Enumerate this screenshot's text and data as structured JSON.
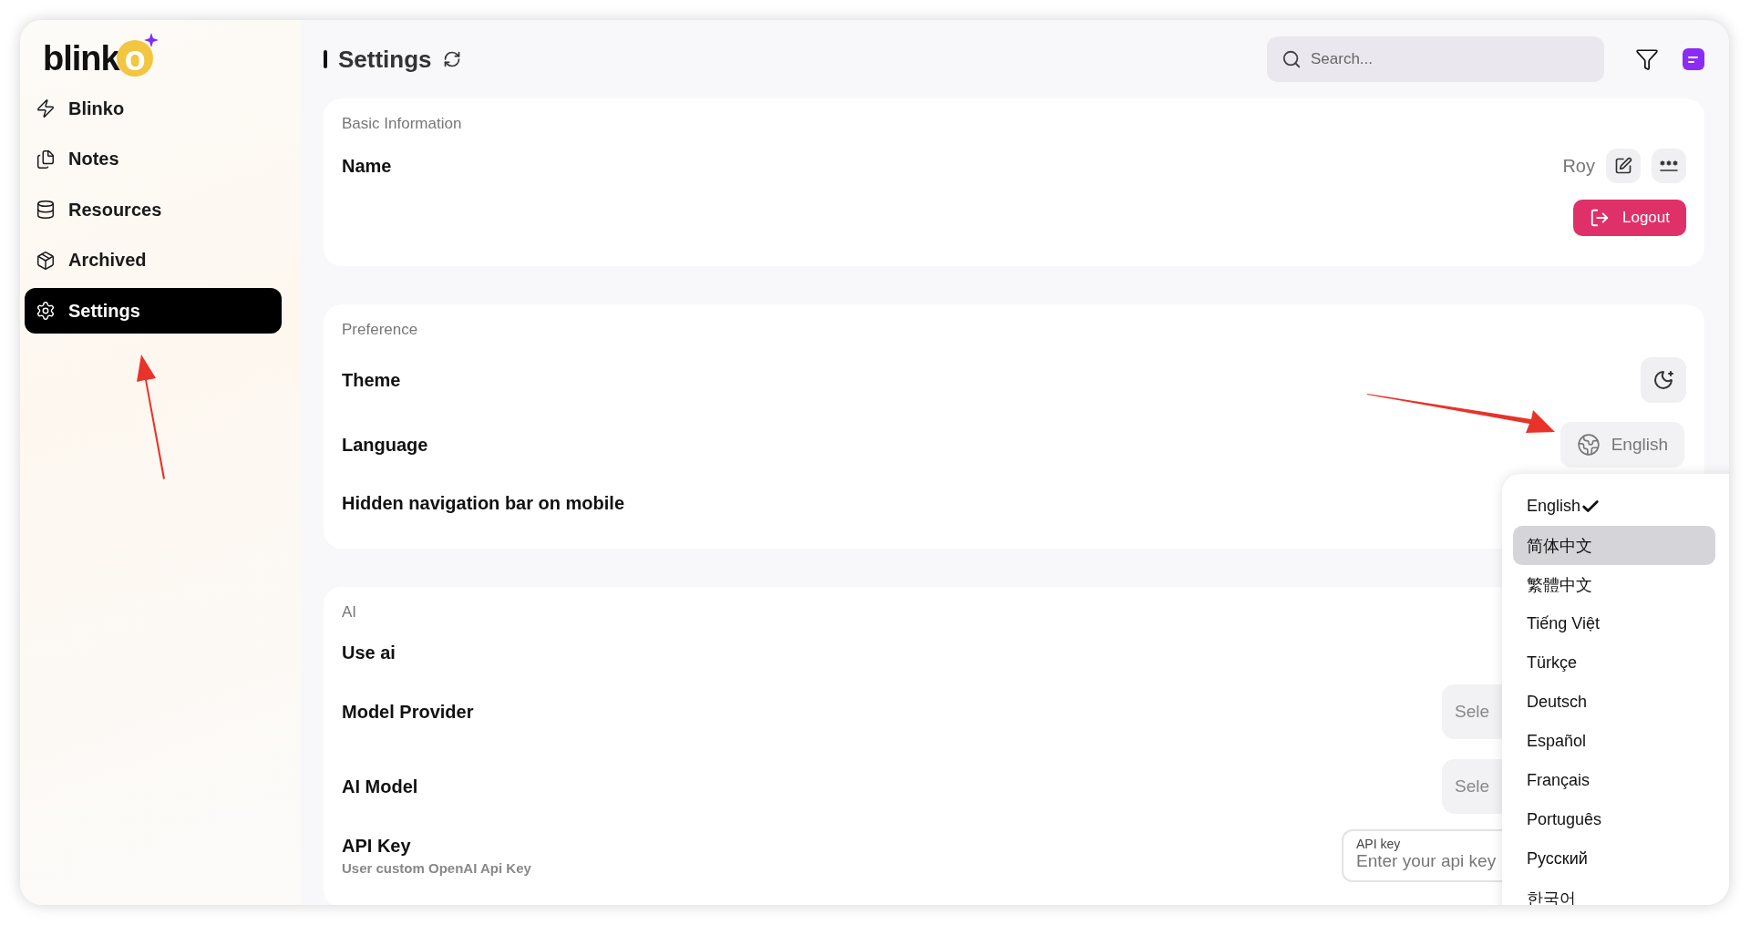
{
  "logo": {
    "text": "blinko"
  },
  "sidebar": {
    "items": [
      {
        "label": "Blinko",
        "selected": false
      },
      {
        "label": "Notes",
        "selected": false
      },
      {
        "label": "Resources",
        "selected": false
      },
      {
        "label": "Archived",
        "selected": false
      },
      {
        "label": "Settings",
        "selected": true
      }
    ]
  },
  "header": {
    "title": "Settings",
    "search": {
      "placeholder": "Search..."
    }
  },
  "sections": [
    {
      "title": "Basic Information",
      "rows": [
        {
          "kind": "name",
          "label": "Name",
          "value": "Roy"
        },
        {
          "kind": "button",
          "button": "Logout"
        }
      ]
    },
    {
      "title": "Preference",
      "rows": [
        {
          "kind": "theme",
          "label": "Theme"
        },
        {
          "kind": "language",
          "label": "Language",
          "value": "English"
        },
        {
          "kind": "plain",
          "label": "Hidden navigation bar on mobile"
        }
      ]
    },
    {
      "title": "AI",
      "rows": [
        {
          "kind": "plain",
          "label": "Use ai"
        },
        {
          "kind": "select",
          "label": "Model Provider",
          "value": "Sele"
        },
        {
          "kind": "select",
          "label": "AI Model",
          "value": "Sele"
        },
        {
          "kind": "input",
          "label": "API Key",
          "description": "User custom OpenAI Api Key",
          "field_label": "API key",
          "placeholder": "Enter your api key"
        }
      ]
    }
  ],
  "dropdown": {
    "items": [
      {
        "label": "English",
        "checked": true,
        "selected": false
      },
      {
        "label": "简体中文",
        "checked": false,
        "selected": true
      },
      {
        "label": "繁體中文",
        "checked": false,
        "selected": false
      },
      {
        "label": "Tiếng Việt",
        "checked": false,
        "selected": false
      },
      {
        "label": "Türkçe",
        "checked": false,
        "selected": false
      },
      {
        "label": "Deutsch",
        "checked": false,
        "selected": false
      },
      {
        "label": "Español",
        "checked": false,
        "selected": false
      },
      {
        "label": "Français",
        "checked": false,
        "selected": false
      },
      {
        "label": "Português",
        "checked": false,
        "selected": false
      },
      {
        "label": "Русский",
        "checked": false,
        "selected": false
      },
      {
        "label": "한국어",
        "checked": false,
        "selected": false
      }
    ]
  }
}
